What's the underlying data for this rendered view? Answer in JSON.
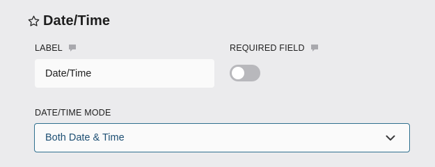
{
  "section": {
    "title": "Date/Time",
    "icon": "star-outline-icon"
  },
  "fields": {
    "label": {
      "label": "LABEL",
      "value": "Date/Time",
      "icon": "comment-bubble-icon"
    },
    "required": {
      "label": "REQUIRED FIELD",
      "enabled": false,
      "icon": "comment-bubble-icon"
    },
    "mode": {
      "label": "DATE/TIME MODE",
      "selected": "Both Date & Time",
      "icon": "chevron-down-icon"
    }
  },
  "colors": {
    "background": "#ebebed",
    "select_border": "#2e6f8e",
    "select_text": "#1d4f73",
    "toggle_off": "#b8b8bc"
  }
}
